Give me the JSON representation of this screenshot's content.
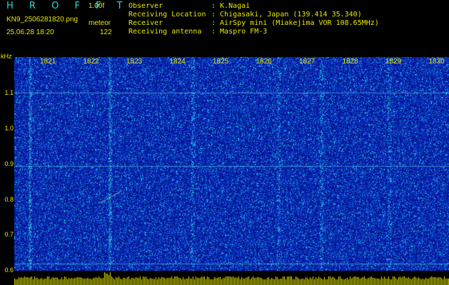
{
  "header": {
    "app_name": "H R O F F T",
    "version": "1.00f",
    "filename": "KN9_2506281820.png",
    "datetime": "25.06.28 18:20",
    "meteor_label": "meteor",
    "meteor_count": "122"
  },
  "meta": {
    "rows": [
      {
        "key": "Observer",
        "value": ": K.Nagai"
      },
      {
        "key": "Receiving Location",
        "value": ": Chigasaki, Japan (139.414 35.340)"
      },
      {
        "key": "Receiver",
        "value": ": AirSpy mini (Miakejima VOR 108.65MHz)"
      },
      {
        "key": "Receiving antenna",
        "value": ": Maspro FM-3"
      }
    ]
  },
  "yaxis": {
    "unit": "kHz",
    "labels": [
      "1.1",
      "1.0",
      "0.9",
      "0.8",
      "0.7",
      "0.6"
    ]
  },
  "xaxis": {
    "labels": [
      "1821",
      "1822",
      "1823",
      "1824",
      "1825",
      "1826",
      "1827",
      "1828",
      "1829",
      "1830"
    ]
  },
  "colors": {
    "background": "#0a1a8c",
    "text": "#e8e800",
    "title": "#2bd8d8",
    "echo_bar": "#e8e800"
  }
}
